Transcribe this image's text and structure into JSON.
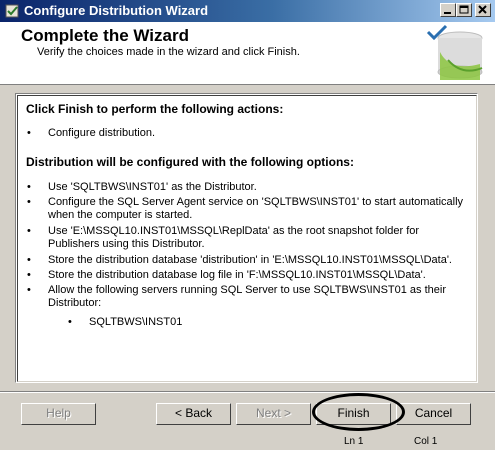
{
  "window": {
    "title": "Configure Distribution Wizard"
  },
  "header": {
    "title": "Complete the Wizard",
    "subtitle": "Verify the choices made in the wizard and click Finish."
  },
  "content": {
    "actions_heading": "Click Finish to perform the following actions:",
    "actions": [
      "Configure distribution."
    ],
    "options_heading": "Distribution will be configured with the following options:",
    "options": [
      "Use 'SQLTBWS\\INST01' as the Distributor.",
      "Configure the SQL Server Agent service on 'SQLTBWS\\INST01' to start automatically when the computer is started.",
      "Use 'E:\\MSSQL10.INST01\\MSSQL\\ReplData' as the root snapshot folder for Publishers using this Distributor.",
      "Store the distribution database 'distribution' in 'E:\\MSSQL10.INST01\\MSSQL\\Data'.",
      "Store the distribution database log file in 'F:\\MSSQL10.INST01\\MSSQL\\Data'.",
      "Allow the following servers running SQL Server to use SQLTBWS\\INST01 as their Distributor:"
    ],
    "servers": [
      "SQLTBWS\\INST01"
    ],
    "bullet": "•"
  },
  "buttons": {
    "help": "Help",
    "back": "< Back",
    "next": "Next >",
    "finish": "Finish",
    "cancel": "Cancel"
  },
  "status": {
    "line": "Ln 1",
    "col": "Col 1"
  }
}
